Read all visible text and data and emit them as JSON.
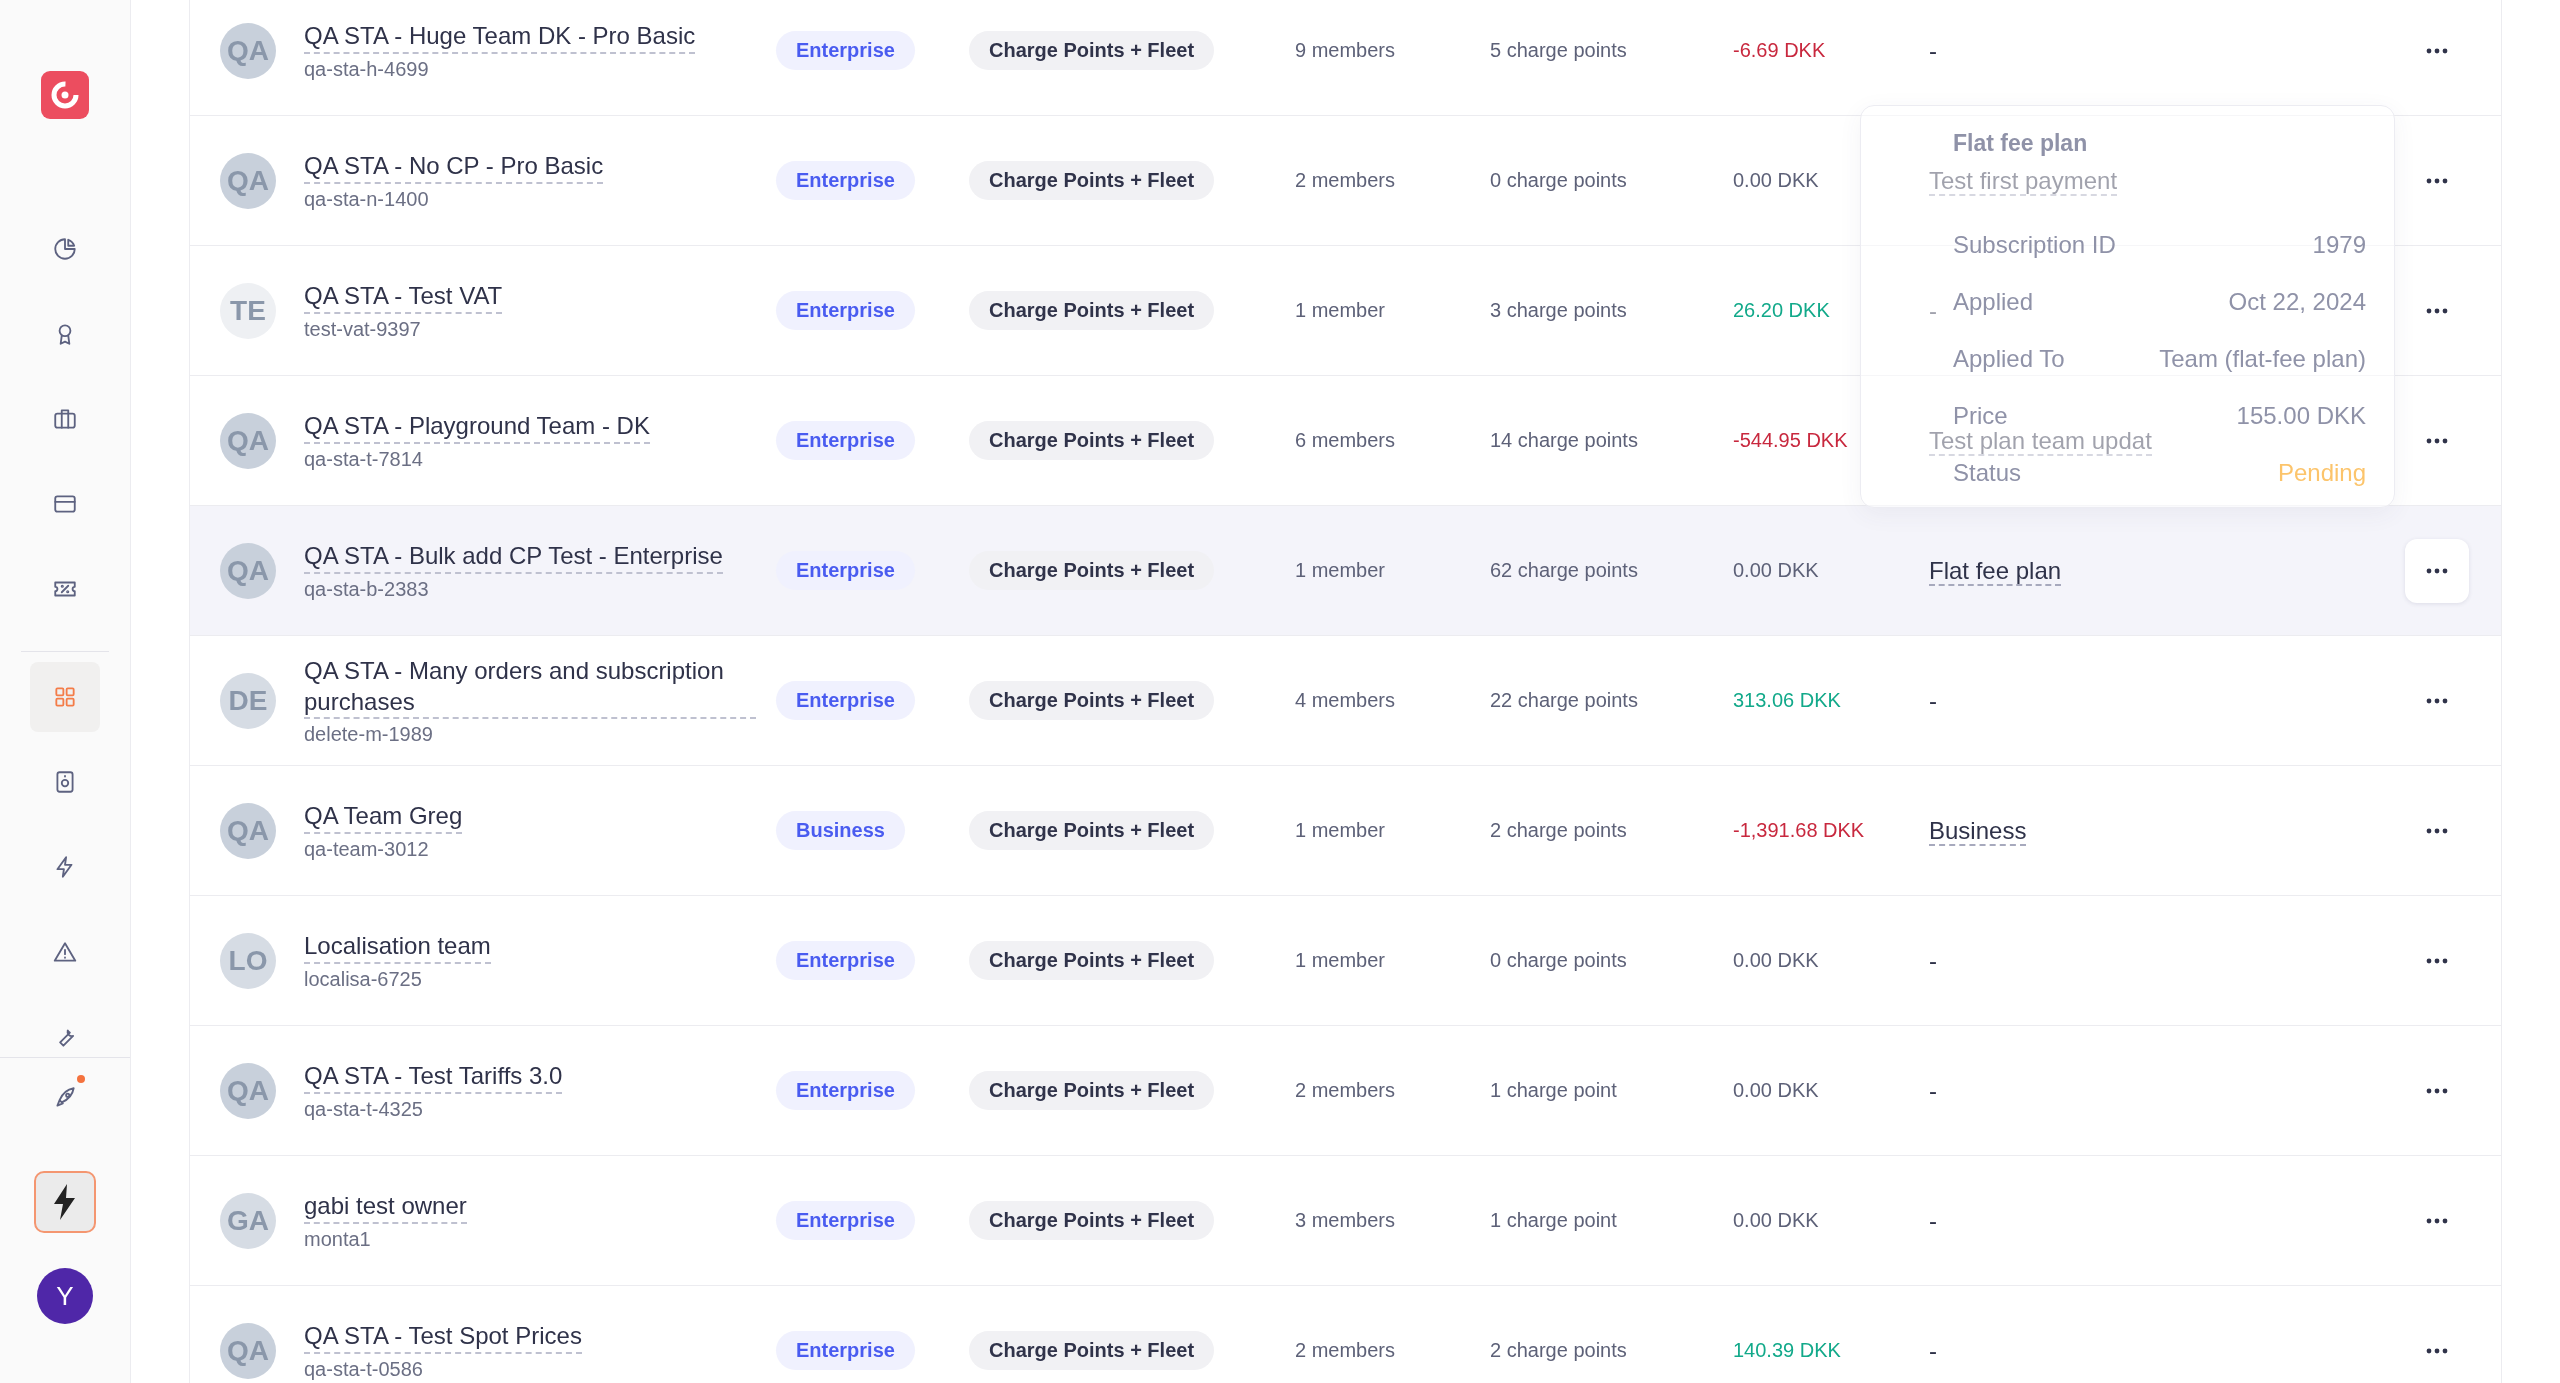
{
  "sidebar": {
    "user_initial": "Y",
    "items": [
      {
        "selected": false
      },
      {
        "selected": false
      },
      {
        "selected": false
      },
      {
        "selected": false
      },
      {
        "selected": false
      },
      {
        "selected": true
      },
      {
        "selected": false
      },
      {
        "selected": false
      },
      {
        "selected": false
      },
      {
        "selected": false
      }
    ],
    "bottom": [
      {
        "notification": true
      }
    ]
  },
  "rows": [
    {
      "initials": "QA",
      "color": "#c8d0db",
      "name": "QA STA - Huge Team DK - Pro Basic",
      "id": "qa-sta-h-4699",
      "plan_type": "Enterprise",
      "product": "Charge Points + Fleet",
      "members": "9 members",
      "charge_points": "5 charge points",
      "balance": "-6.69 DKK",
      "kind": "negative",
      "plan": "-",
      "plan_link": false,
      "highlighted": false
    },
    {
      "initials": "QA",
      "color": "#c8d0db",
      "name": "QA STA - No CP - Pro Basic",
      "id": "qa-sta-n-1400",
      "plan_type": "Enterprise",
      "product": "Charge Points + Fleet",
      "members": "2 members",
      "charge_points": "0 charge points",
      "balance": "0.00 DKK",
      "kind": "neutral",
      "plan": "Test first payment",
      "plan_link": true,
      "highlighted": false
    },
    {
      "initials": "TE",
      "color": "#eef0f3",
      "name": "QA STA - Test VAT",
      "id": "test-vat-9397",
      "plan_type": "Enterprise",
      "product": "Charge Points + Fleet",
      "members": "1 member",
      "charge_points": "3 charge points",
      "balance": "26.20 DKK",
      "kind": "positive",
      "plan": "-",
      "plan_link": false,
      "highlighted": false
    },
    {
      "initials": "QA",
      "color": "#c8d0db",
      "name": "QA STA - Playground Team - DK",
      "id": "qa-sta-t-7814",
      "plan_type": "Enterprise",
      "product": "Charge Points + Fleet",
      "members": "6 members",
      "charge_points": "14 charge points",
      "balance": "-544.95 DKK",
      "kind": "negative",
      "plan": "Test plan team updat",
      "plan_link": true,
      "highlighted": false
    },
    {
      "initials": "QA",
      "color": "#c8d0db",
      "name": "QA STA - Bulk add CP Test - Enterprise",
      "id": "qa-sta-b-2383",
      "plan_type": "Enterprise",
      "product": "Charge Points + Fleet",
      "members": "1 member",
      "charge_points": "62 charge points",
      "balance": "0.00 DKK",
      "kind": "neutral",
      "plan": "Flat fee plan",
      "plan_link": true,
      "highlighted": true
    },
    {
      "initials": "DE",
      "color": "#d6dce4",
      "name": "QA STA - Many orders and subscription purchases",
      "id": "delete-m-1989",
      "plan_type": "Enterprise",
      "product": "Charge Points + Fleet",
      "members": "4 members",
      "charge_points": "22 charge points",
      "balance": "313.06 DKK",
      "kind": "positive",
      "plan": "-",
      "plan_link": false,
      "highlighted": false
    },
    {
      "initials": "QA",
      "color": "#c8d0db",
      "name": "QA Team Greg",
      "id": "qa-team-3012",
      "plan_type": "Business",
      "product": "Charge Points + Fleet",
      "members": "1 member",
      "charge_points": "2 charge points",
      "balance": "-1,391.68 DKK",
      "kind": "negative",
      "plan": "Business",
      "plan_link": true,
      "highlighted": false
    },
    {
      "initials": "LO",
      "color": "#d6dce4",
      "name": "Localisation team",
      "id": "localisa-6725",
      "plan_type": "Enterprise",
      "product": "Charge Points + Fleet",
      "members": "1 member",
      "charge_points": "0 charge points",
      "balance": "0.00 DKK",
      "kind": "neutral",
      "plan": "-",
      "plan_link": false,
      "highlighted": false
    },
    {
      "initials": "QA",
      "color": "#c8d0db",
      "name": "QA STA - Test Tariffs 3.0",
      "id": "qa-sta-t-4325",
      "plan_type": "Enterprise",
      "product": "Charge Points + Fleet",
      "members": "2 members",
      "charge_points": "1 charge point",
      "balance": "0.00 DKK",
      "kind": "neutral",
      "plan": "-",
      "plan_link": false,
      "highlighted": false
    },
    {
      "initials": "GA",
      "color": "#d6dce4",
      "name": "gabi test owner",
      "id": "monta1",
      "plan_type": "Enterprise",
      "product": "Charge Points + Fleet",
      "members": "3 members",
      "charge_points": "1 charge point",
      "balance": "0.00 DKK",
      "kind": "neutral",
      "plan": "-",
      "plan_link": false,
      "highlighted": false
    },
    {
      "initials": "QA",
      "color": "#c8d0db",
      "name": "QA STA - Test Spot Prices",
      "id": "qa-sta-t-0586",
      "plan_type": "Enterprise",
      "product": "Charge Points + Fleet",
      "members": "2 members",
      "charge_points": "2 charge points",
      "balance": "140.39 DKK",
      "kind": "positive",
      "plan": "-",
      "plan_link": false,
      "highlighted": false
    }
  ],
  "tooltip": {
    "title": "Flat fee plan",
    "fields": [
      {
        "label": "Subscription ID",
        "value": "1979",
        "kind": "plain"
      },
      {
        "label": "Applied",
        "value": "Oct 22, 2024",
        "kind": "plain"
      },
      {
        "label": "Applied To",
        "value": "Team (flat-fee plan)",
        "kind": "plain"
      },
      {
        "label": "Price",
        "value": "155.00 DKK",
        "kind": "plain"
      },
      {
        "label": "Status",
        "value": "Pending",
        "kind": "pending"
      }
    ]
  }
}
